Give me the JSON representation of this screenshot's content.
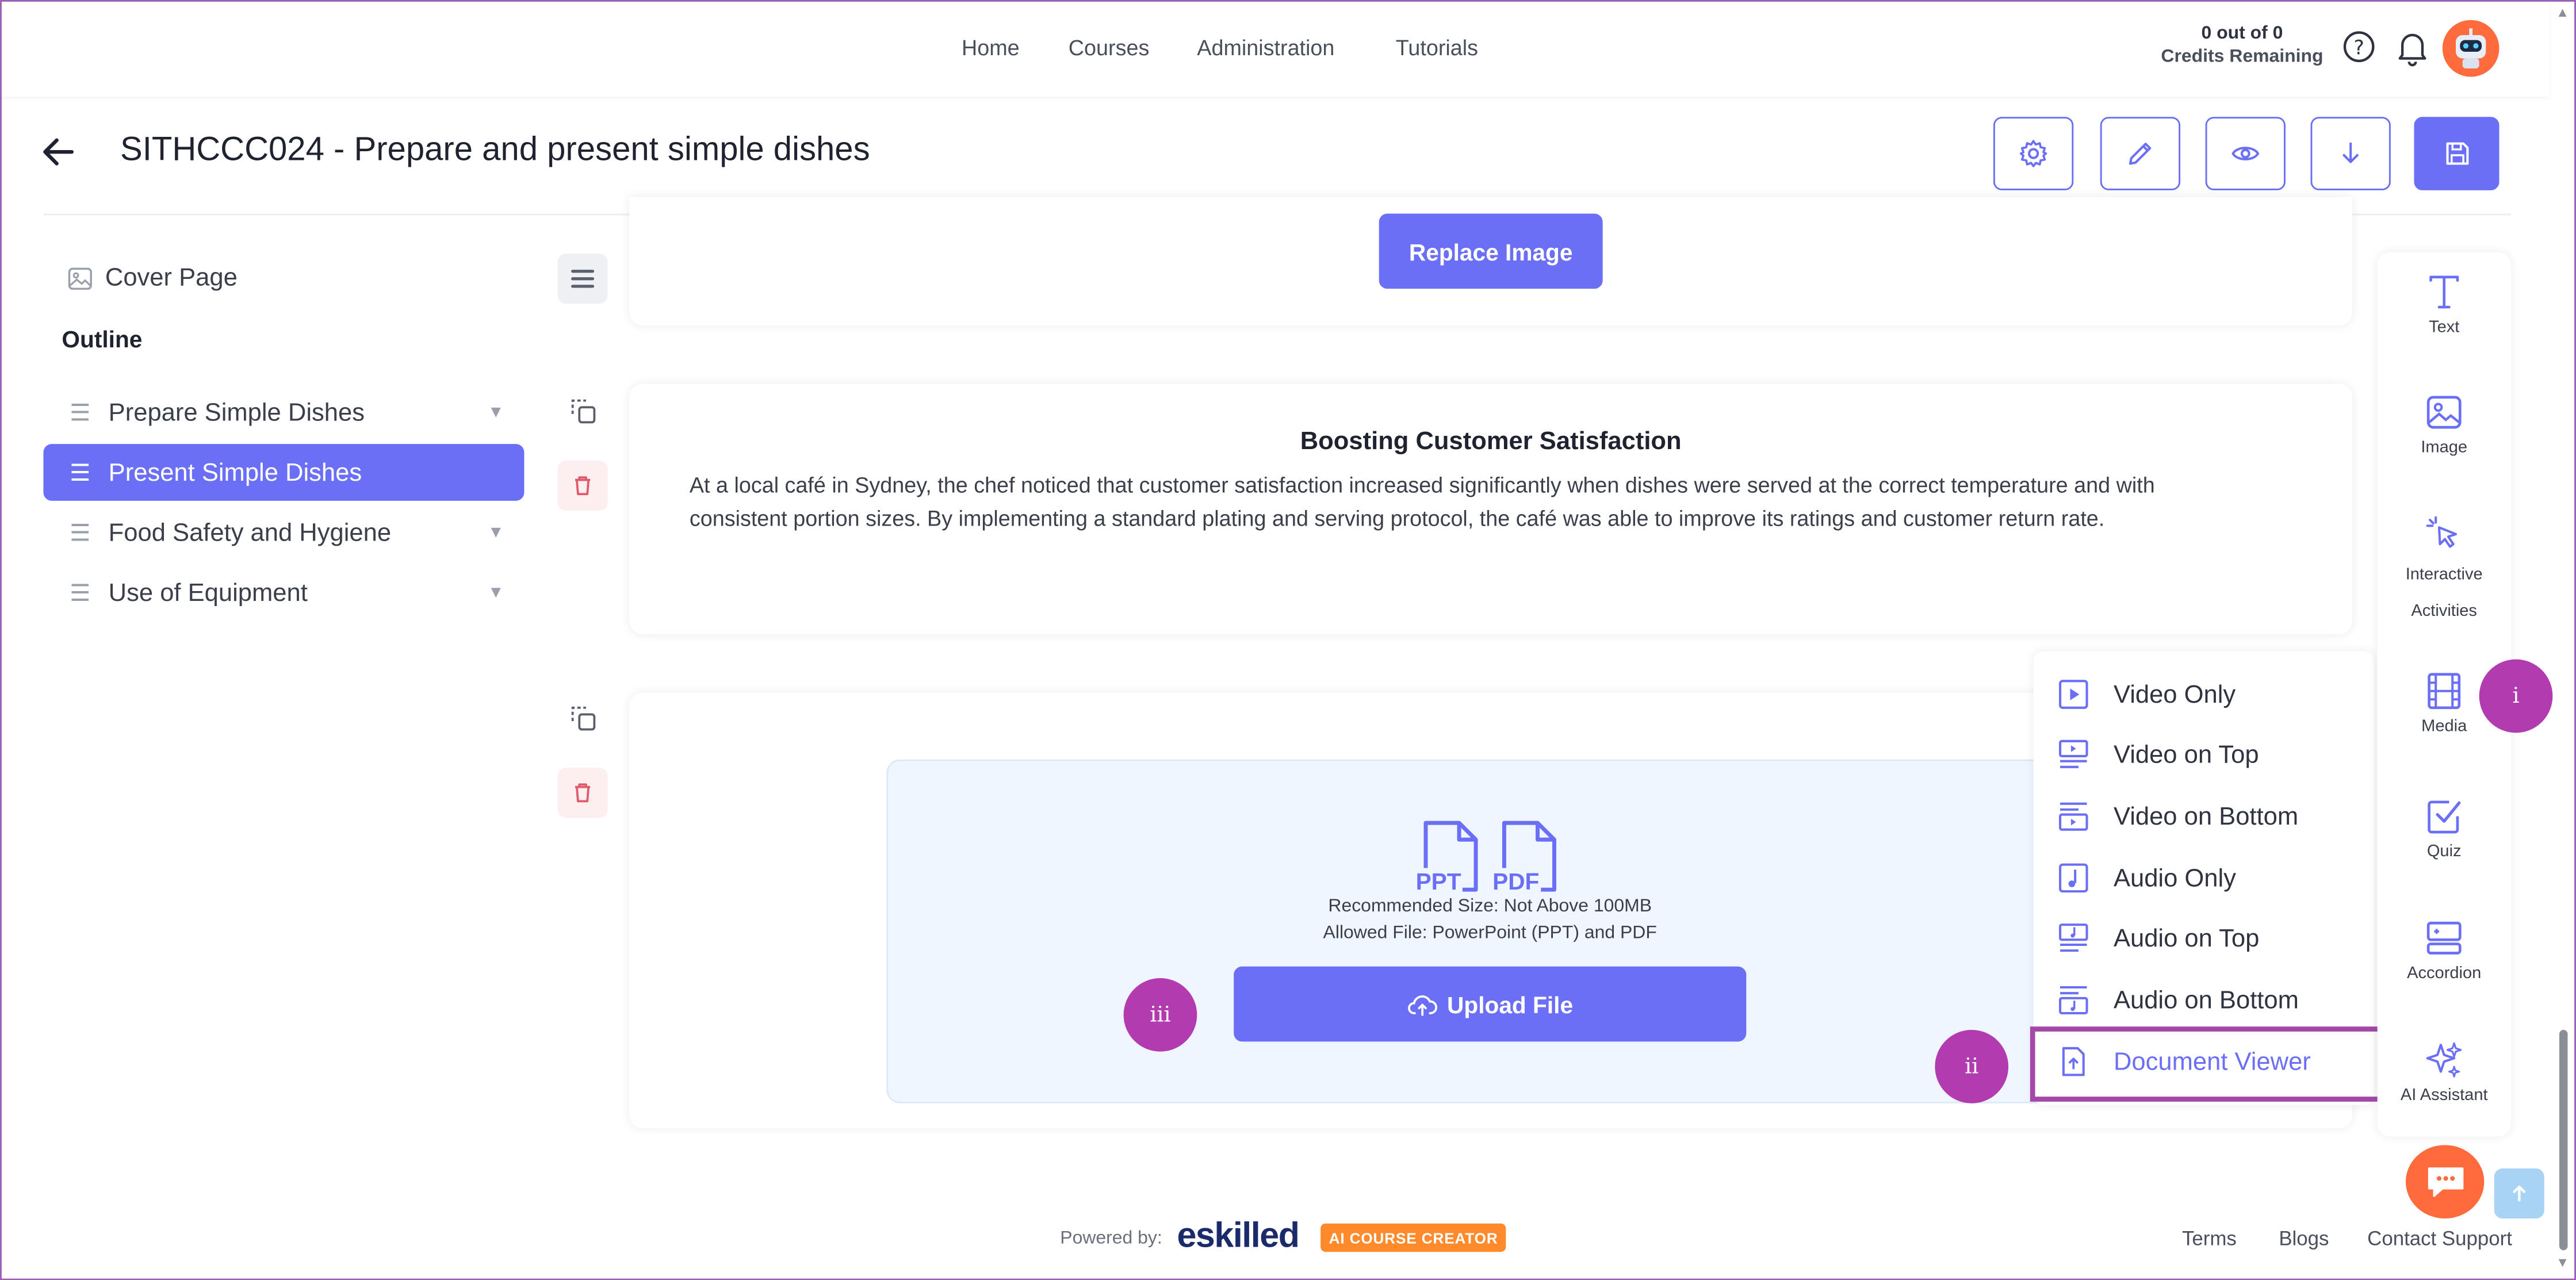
{
  "nav": {
    "items": [
      "Home",
      "Courses",
      "Administration",
      "Tutorials"
    ]
  },
  "credits": {
    "count": "0 out of 0",
    "label": "Credits Remaining"
  },
  "header": {
    "title": "SITHCCC024 - Prepare and present simple dishes"
  },
  "sidebar": {
    "cover_page": "Cover Page",
    "outline_label": "Outline",
    "items": [
      {
        "label": "Prepare Simple Dishes"
      },
      {
        "label": "Present Simple Dishes"
      },
      {
        "label": "Food Safety and Hygiene"
      },
      {
        "label": "Use of Equipment"
      }
    ]
  },
  "cover_block": {
    "replace_button": "Replace Image"
  },
  "text_block": {
    "title": "Boosting Customer Satisfaction",
    "body": "At a local café in Sydney, the chef noticed that customer satisfaction increased significantly when dishes were served at the correct temperature and with consistent portion sizes. By implementing a standard plating and serving protocol, the café was able to improve its ratings and customer return rate."
  },
  "upload_block": {
    "ppt_label": "PPT",
    "pdf_label": "PDF",
    "recommended": "Recommended Size: Not Above 100MB",
    "allowed": "Allowed File: PowerPoint (PPT) and PDF",
    "upload_button": "Upload File"
  },
  "media_menu": {
    "items": [
      "Video Only",
      "Video on Top",
      "Video on Bottom",
      "Audio Only",
      "Audio on Top",
      "Audio on Bottom",
      "Document Viewer"
    ]
  },
  "toolbar": {
    "text": "Text",
    "image": "Image",
    "interactive_1": "Interactive",
    "interactive_2": "Activities",
    "media": "Media",
    "quiz": "Quiz",
    "accordion": "Accordion",
    "ai": "AI Assistant"
  },
  "badges": {
    "i": "i",
    "ii": "ii",
    "iii": "iii"
  },
  "footer": {
    "powered_by": "Powered by:",
    "brand": "eskilled",
    "brand_tag": "AI COURSE CREATOR",
    "links": [
      "Terms",
      "Blogs",
      "Contact Support"
    ]
  },
  "colors": {
    "accent": "#6b6ff5",
    "badge": "#b23bb0",
    "highlight": "#a347a8",
    "danger": "#e05a6a"
  }
}
